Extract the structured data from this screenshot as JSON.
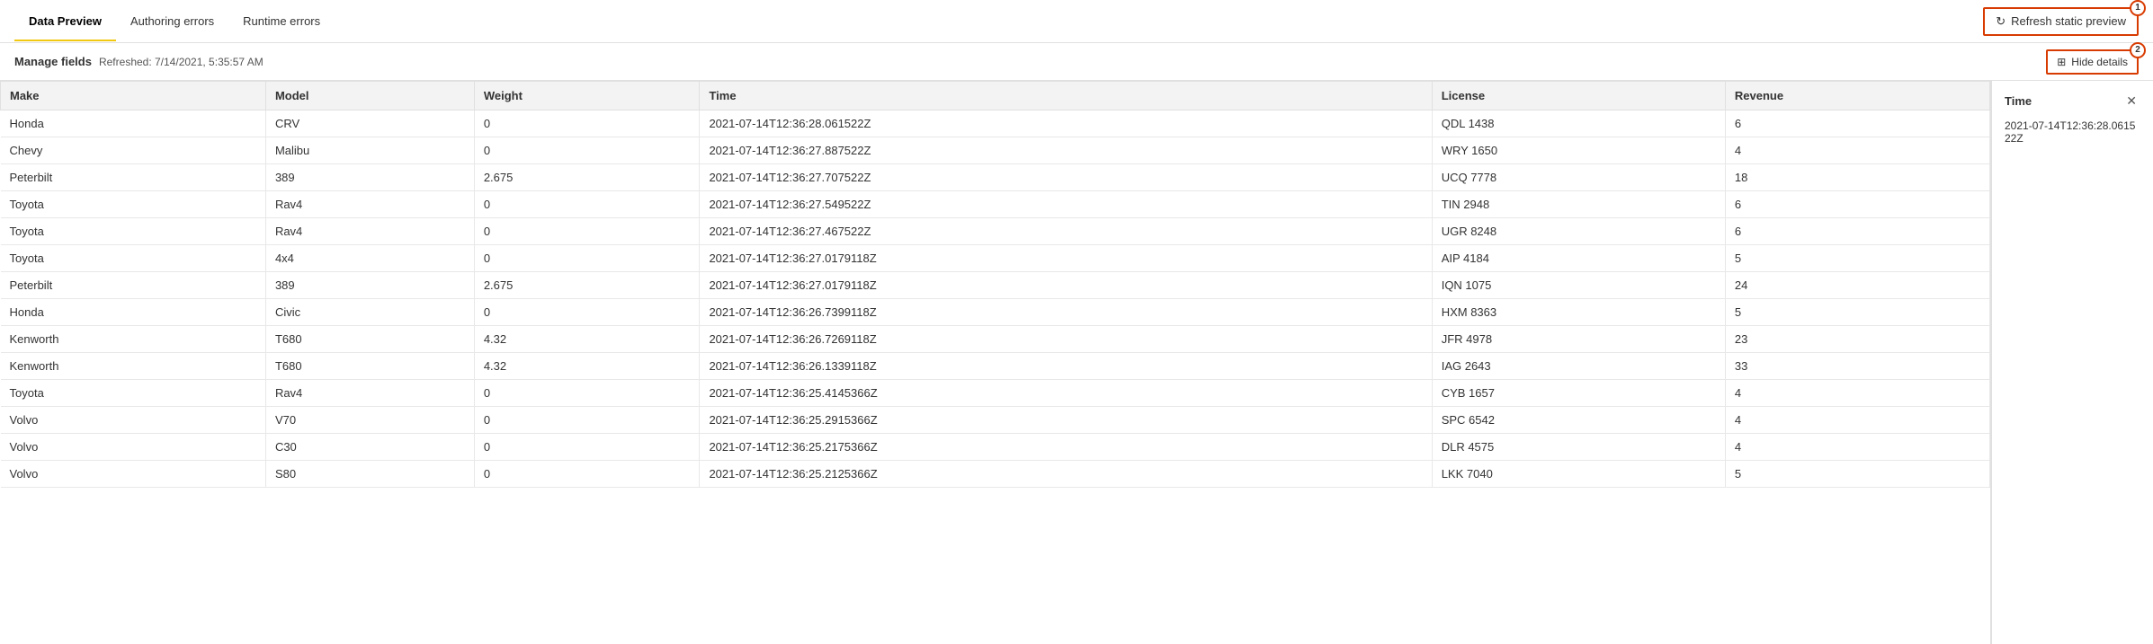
{
  "tabs": [
    {
      "id": "data-preview",
      "label": "Data Preview",
      "active": true
    },
    {
      "id": "authoring-errors",
      "label": "Authoring errors",
      "active": false
    },
    {
      "id": "runtime-errors",
      "label": "Runtime errors",
      "active": false
    }
  ],
  "refresh_button": {
    "label": "Refresh static preview",
    "badge": "1"
  },
  "toolbar": {
    "manage_fields": "Manage fields",
    "refreshed": "Refreshed: 7/14/2021, 5:35:57 AM",
    "hide_details": "Hide details",
    "badge": "2"
  },
  "table": {
    "columns": [
      "Make",
      "Model",
      "Weight",
      "Time",
      "License",
      "Revenue"
    ],
    "rows": [
      [
        "Honda",
        "CRV",
        "0",
        "2021-07-14T12:36:28.061522Z",
        "QDL 1438",
        "6"
      ],
      [
        "Chevy",
        "Malibu",
        "0",
        "2021-07-14T12:36:27.887522Z",
        "WRY 1650",
        "4"
      ],
      [
        "Peterbilt",
        "389",
        "2.675",
        "2021-07-14T12:36:27.707522Z",
        "UCQ 7778",
        "18"
      ],
      [
        "Toyota",
        "Rav4",
        "0",
        "2021-07-14T12:36:27.549522Z",
        "TIN 2948",
        "6"
      ],
      [
        "Toyota",
        "Rav4",
        "0",
        "2021-07-14T12:36:27.467522Z",
        "UGR 8248",
        "6"
      ],
      [
        "Toyota",
        "4x4",
        "0",
        "2021-07-14T12:36:27.0179118Z",
        "AIP 4184",
        "5"
      ],
      [
        "Peterbilt",
        "389",
        "2.675",
        "2021-07-14T12:36:27.0179118Z",
        "IQN 1075",
        "24"
      ],
      [
        "Honda",
        "Civic",
        "0",
        "2021-07-14T12:36:26.7399118Z",
        "HXM 8363",
        "5"
      ],
      [
        "Kenworth",
        "T680",
        "4.32",
        "2021-07-14T12:36:26.7269118Z",
        "JFR 4978",
        "23"
      ],
      [
        "Kenworth",
        "T680",
        "4.32",
        "2021-07-14T12:36:26.1339118Z",
        "IAG 2643",
        "33"
      ],
      [
        "Toyota",
        "Rav4",
        "0",
        "2021-07-14T12:36:25.4145366Z",
        "CYB 1657",
        "4"
      ],
      [
        "Volvo",
        "V70",
        "0",
        "2021-07-14T12:36:25.2915366Z",
        "SPC 6542",
        "4"
      ],
      [
        "Volvo",
        "C30",
        "0",
        "2021-07-14T12:36:25.2175366Z",
        "DLR 4575",
        "4"
      ],
      [
        "Volvo",
        "S80",
        "0",
        "2021-07-14T12:36:25.2125366Z",
        "LKK 7040",
        "5"
      ]
    ]
  },
  "side_panel": {
    "title": "Time",
    "value": "2021-07-14T12:36:28.061522Z"
  }
}
